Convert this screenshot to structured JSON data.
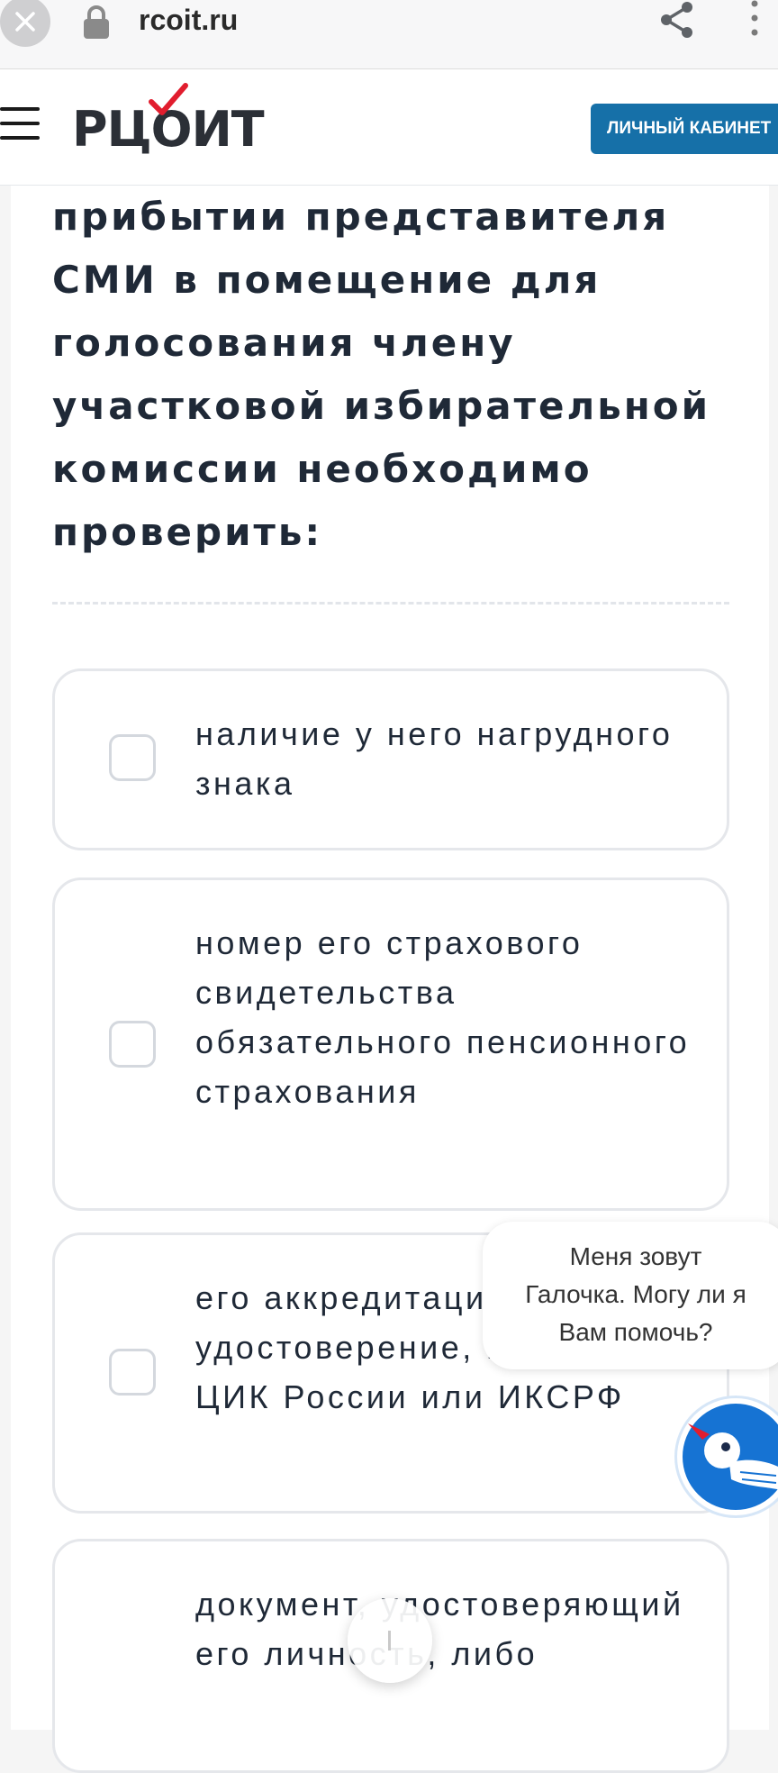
{
  "browser": {
    "url": "rcoit.ru",
    "close_icon": "close-icon",
    "lock_icon": "lock-icon",
    "share_icon": "share-icon",
    "menu_icon": "more-vert-icon"
  },
  "header": {
    "menu_icon": "hamburger-icon",
    "logo_text": "РЦОИТ",
    "logo_accent_color": "#e11d2e",
    "cabinet_button": "ЛИЧНЫЙ КАБИНЕТ",
    "cabinet_button_color": "#1670a8"
  },
  "question": {
    "text": "прибытии представителя СМИ в помещение для голосования члену участковой избирательной комиссии необходимо проверить:"
  },
  "options": [
    {
      "text": "наличие у него нагрудного знака",
      "checked": false
    },
    {
      "text": "номер его страхового свидетельства обязательного пенсионного страхования",
      "checked": false
    },
    {
      "text": "его аккредитационное удостоверение, выданное ЦИК России или ИКСРФ",
      "checked": false
    },
    {
      "text": "документ, удостоверяющий его личность, либо",
      "checked": false
    }
  ],
  "chat": {
    "lines": [
      "Меня зовут",
      "Галочка. Могу ли я",
      "Вам помочь?"
    ],
    "avatar_icon": "bird-mascot-icon",
    "avatar_color": "#1673d3"
  }
}
